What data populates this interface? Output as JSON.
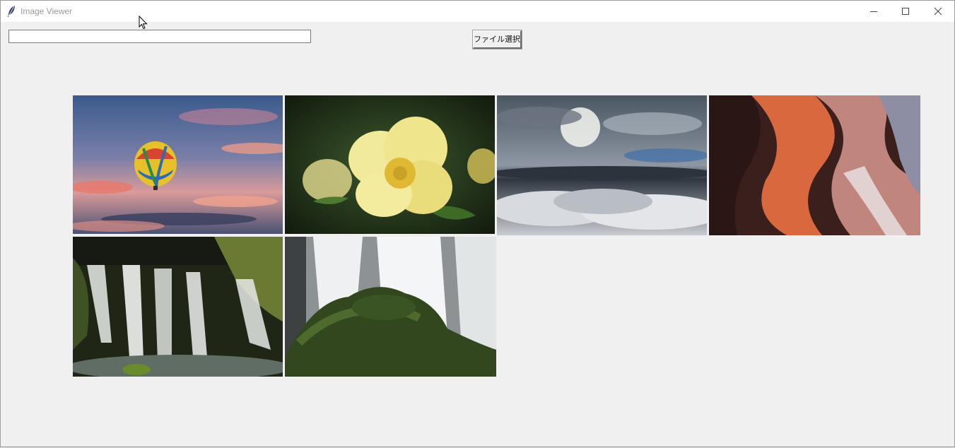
{
  "window": {
    "title": "Image Viewer",
    "app_icon": "feather-icon",
    "controls": {
      "minimize_icon": "minimize-icon",
      "maximize_icon": "maximize-icon",
      "close_icon": "close-icon"
    }
  },
  "toolbar": {
    "path_input": {
      "value": "",
      "placeholder": ""
    },
    "file_select_label": "ファイル選択"
  },
  "gallery": {
    "images": [
      {
        "subject": "hot air balloon at sunset"
      },
      {
        "subject": "yellow flower"
      },
      {
        "subject": "clouds above sea of clouds"
      },
      {
        "subject": "slot canyon sandstone"
      },
      {
        "subject": "mossy waterfall"
      },
      {
        "subject": "waterfall behind tree"
      }
    ]
  },
  "colors": {
    "window_background": "#f0f0f0",
    "titlebar_background": "#ffffff",
    "title_text": "#9a9a9a"
  }
}
